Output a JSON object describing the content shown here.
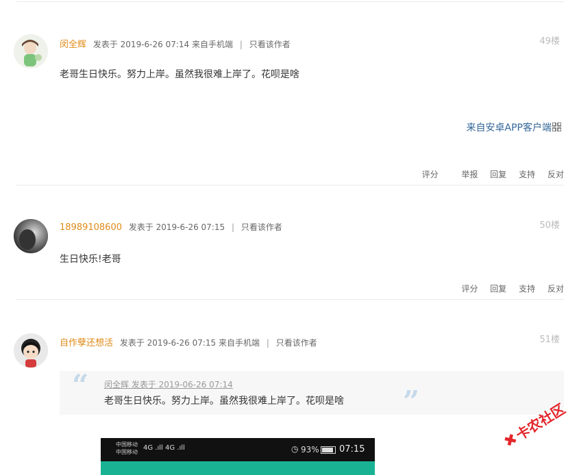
{
  "posts": [
    {
      "author": "闵全辉",
      "meta": "发表于 2019-6-26 07:14 来自手机端",
      "only_author": "只看该作者",
      "floor": "49楼",
      "content": "老哥生日快乐。努力上岸。虽然我很难上岸了。花呗是啥",
      "from_app": "来自安卓APP客户端",
      "actions": [
        "评分",
        "举报",
        "回复",
        "支持",
        "反对"
      ]
    },
    {
      "author": "18989108600",
      "meta": "发表于 2019-6-26 07:15",
      "only_author": "只看该作者",
      "floor": "50楼",
      "content": "生日快乐!老哥",
      "actions": [
        "评分",
        "回复",
        "支持",
        "反对"
      ]
    },
    {
      "author": "自作孽还想活",
      "meta": "发表于 2019-6-26 07:15 来自手机端",
      "only_author": "只看该作者",
      "floor": "51楼",
      "quote": {
        "meta": "闵全辉 发表于 2019-06-26 07:14",
        "text": "老哥生日快乐。努力上岸。虽然我很难上岸了。花呗是啥"
      }
    }
  ],
  "phone_status": {
    "carrier_1": "中国移动",
    "carrier_2": "中国移动",
    "signal": "4G .ıll 4G .ıll",
    "battery": "93%",
    "time": "07:15"
  },
  "watermark": "卡农社区",
  "colors": {
    "author": "#e08a17",
    "link": "#336699",
    "teal": "#19b394",
    "watermark": "#e3262b"
  }
}
